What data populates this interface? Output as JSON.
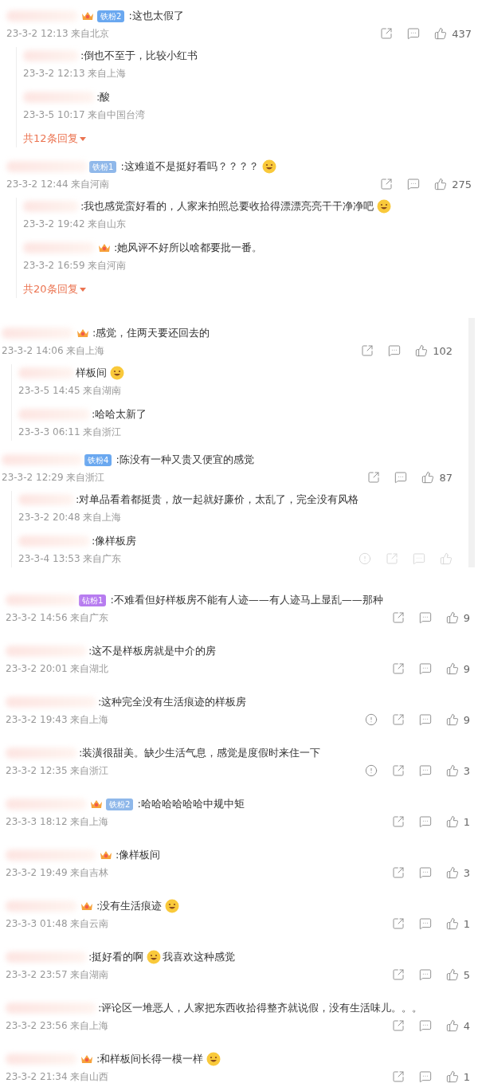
{
  "sections": [
    {
      "scrollbar": false,
      "comments": [
        {
          "crown": true,
          "badge": {
            "text": "铁粉2",
            "color": "#6aa8f0"
          },
          "parts": [
            {
              "kind": "text",
              "text": ":这也太假了"
            }
          ],
          "time": "23-3-2 12:13 来自北京",
          "actions": {
            "report": false,
            "faded": false,
            "likes": "437"
          },
          "replies": [
            {
              "crown": false,
              "parts": [
                {
                  "kind": "text",
                  "text": ":倒也不至于，比较小红书"
                }
              ],
              "time": "23-3-2 12:13 来自上海"
            },
            {
              "crown": false,
              "parts": [
                {
                  "kind": "text",
                  "text": ":酸"
                }
              ],
              "time": "23-3-5 10:17 来自中国台湾"
            }
          ],
          "more": "共12条回复"
        },
        {
          "crown": false,
          "badge": {
            "text": "铁粉1",
            "color": "#8fb8ea"
          },
          "parts": [
            {
              "kind": "text",
              "text": ":这难道不是挺好看吗？？？？"
            },
            {
              "kind": "emoji"
            }
          ],
          "time": "23-3-2 12:44 来自河南",
          "actions": {
            "report": false,
            "faded": false,
            "likes": "275"
          },
          "replies": [
            {
              "crown": false,
              "parts": [
                {
                  "kind": "text",
                  "text": ":我也感觉蛮好看的，人家来拍照总要收拾得漂漂亮亮干干净净吧"
                },
                {
                  "kind": "emoji"
                }
              ],
              "time": "23-3-2 19:42 来自山东"
            },
            {
              "crown": true,
              "parts": [
                {
                  "kind": "text",
                  "text": ":她风评不好所以啥都要批一番。"
                }
              ],
              "time": "23-3-2 16:59 来自河南"
            }
          ],
          "more": "共20条回复"
        }
      ]
    },
    {
      "scrollbar": true,
      "comments": [
        {
          "crown": true,
          "parts": [
            {
              "kind": "text",
              "text": ":感觉，住两天要还回去的"
            }
          ],
          "time": "23-3-2 14:06 来自上海",
          "actions": {
            "report": false,
            "faded": false,
            "likes": "102"
          },
          "replies": [
            {
              "crown": false,
              "parts": [
                {
                  "kind": "text",
                  "text": "样板间"
                },
                {
                  "kind": "emoji"
                }
              ],
              "time": "23-3-5 14:45 来自湖南"
            },
            {
              "crown": false,
              "parts": [
                {
                  "kind": "text",
                  "text": ":哈哈太新了"
                }
              ],
              "time": "23-3-3 06:11 来自浙江"
            }
          ]
        },
        {
          "crown": false,
          "badge": {
            "text": "铁粉4",
            "color": "#6aa8f0"
          },
          "parts": [
            {
              "kind": "text",
              "text": ":陈没有一种又贵又便宜的感觉"
            }
          ],
          "time": "23-3-2 12:29 来自浙江",
          "actions": {
            "report": false,
            "faded": false,
            "likes": "87"
          },
          "replies": [
            {
              "crown": false,
              "parts": [
                {
                  "kind": "text",
                  "text": ":对单品看着都挺贵，放一起就好廉价，太乱了，完全没有风格"
                }
              ],
              "time": "23-3-2 20:48 来自上海"
            },
            {
              "crown": false,
              "parts": [
                {
                  "kind": "text",
                  "text": ":像样板房"
                }
              ],
              "time": "23-3-4 13:53 来自广东",
              "actions": {
                "report": true,
                "faded": true
              }
            }
          ]
        }
      ]
    },
    {
      "scrollbar": false,
      "comments": [
        {
          "crown": false,
          "badge": {
            "text": "钻粉1",
            "color": "#b77cf0"
          },
          "parts": [
            {
              "kind": "text",
              "text": ":不难看但好样板房不能有人迹——有人迹马上显乱——那种"
            }
          ],
          "time": "23-3-2 14:56 来自广东",
          "actions": {
            "report": false,
            "faded": false,
            "likes": "9"
          }
        },
        {
          "crown": false,
          "parts": [
            {
              "kind": "text",
              "text": ":这不是样板房就是中介的房"
            }
          ],
          "time": "23-3-2 20:01 来自湖北",
          "actions": {
            "report": false,
            "faded": false,
            "likes": "9"
          }
        },
        {
          "crown": false,
          "parts": [
            {
              "kind": "text",
              "text": ":这种完全没有生活痕迹的样板房"
            }
          ],
          "time": "23-3-2 19:43 来自上海",
          "actions": {
            "report": true,
            "faded": false,
            "likes": "9"
          }
        },
        {
          "crown": false,
          "parts": [
            {
              "kind": "text",
              "text": ":装潢很甜美。缺少生活气息，感觉是度假时来住一下"
            }
          ],
          "time": "23-3-2 12:35 来自浙江",
          "actions": {
            "report": true,
            "faded": false,
            "likes": "3"
          }
        },
        {
          "crown": true,
          "badge": {
            "text": "铁粉2",
            "color": "#8fb8ea"
          },
          "parts": [
            {
              "kind": "text",
              "text": ":哈哈哈哈哈哈中规中矩"
            }
          ],
          "time": "23-3-3 18:12 来自上海",
          "actions": {
            "report": false,
            "faded": false,
            "likes": "1"
          }
        },
        {
          "crown": true,
          "parts": [
            {
              "kind": "text",
              "text": ":像样板间"
            }
          ],
          "time": "23-3-2 19:49 来自吉林",
          "actions": {
            "report": false,
            "faded": false,
            "likes": "3"
          }
        },
        {
          "crown": true,
          "parts": [
            {
              "kind": "text",
              "text": ":没有生活痕迹"
            },
            {
              "kind": "emoji"
            }
          ],
          "time": "23-3-3 01:48 来自云南",
          "actions": {
            "report": false,
            "faded": false,
            "likes": "1"
          }
        },
        {
          "crown": false,
          "parts": [
            {
              "kind": "text",
              "text": ":挺好看的啊"
            },
            {
              "kind": "emoji"
            },
            {
              "kind": "text",
              "text": "我喜欢这种感觉"
            }
          ],
          "time": "23-3-2 23:57 来自湖南",
          "actions": {
            "report": false,
            "faded": false,
            "likes": "5"
          }
        },
        {
          "crown": false,
          "parts": [
            {
              "kind": "text",
              "text": ":评论区一堆恶人，人家把东西收拾得整齐就说假，没有生活味儿。。。"
            }
          ],
          "time": "23-3-2 23:56 来自上海",
          "actions": {
            "report": false,
            "faded": false,
            "likes": "4"
          }
        },
        {
          "crown": true,
          "parts": [
            {
              "kind": "text",
              "text": ":和样板间长得一模一样"
            },
            {
              "kind": "emoji"
            }
          ],
          "time": "23-3-2 21:34 来自山西",
          "actions": {
            "report": false,
            "faded": false,
            "likes": "1"
          }
        }
      ]
    }
  ]
}
